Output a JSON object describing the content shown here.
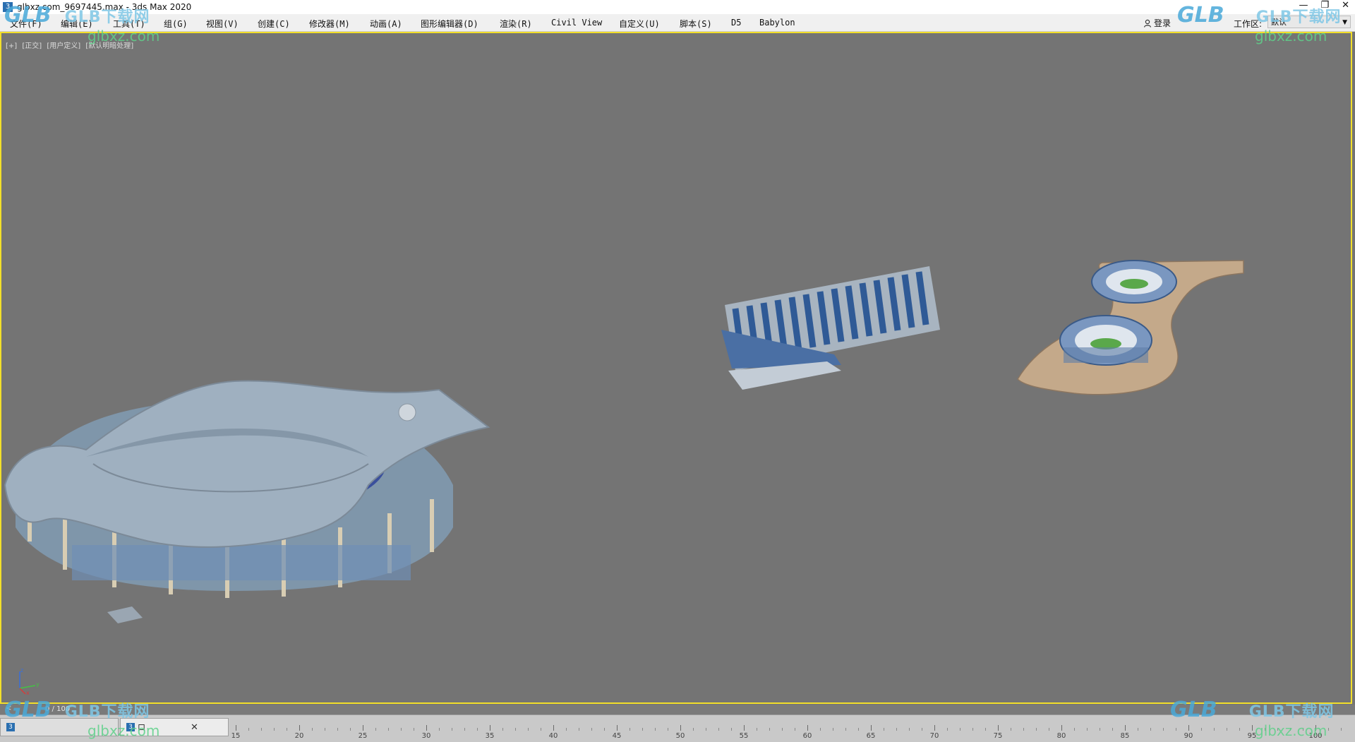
{
  "window": {
    "title": "glbxz.com_9697445.max - 3ds Max 2020",
    "app_icon": "3"
  },
  "menu": {
    "items": [
      "文件(F)",
      "编辑(E)",
      "工具(T)",
      "组(G)",
      "视图(V)",
      "创建(C)",
      "修改器(M)",
      "动画(A)",
      "图形编辑器(D)",
      "渲染(R)",
      "Civil View",
      "自定义(U)",
      "脚本(S)",
      "D5",
      "Babylon"
    ],
    "login_label": "登录",
    "workspace_label": "工作区:",
    "workspace_value": "默认"
  },
  "viewport": {
    "labels": [
      "[+]",
      "[正交]",
      "[用户定义]",
      "[默认明暗处理]"
    ],
    "border_color": "#f2df2a",
    "background": "#747474"
  },
  "axis": {
    "x": "x",
    "y": "y",
    "z": "z"
  },
  "status": {
    "frame_counter": "0 / 100",
    "arrow": "<"
  },
  "tabs": [
    {
      "icon": "3",
      "label": ""
    },
    {
      "icon": "3",
      "label": "口"
    }
  ],
  "timeline": {
    "ticks": [
      "15",
      "20",
      "25",
      "30",
      "35",
      "40",
      "45",
      "50",
      "55",
      "60",
      "65",
      "70",
      "75",
      "80",
      "85",
      "90",
      "95",
      "100"
    ]
  },
  "watermarks": {
    "logo": "GLB",
    "brand": "GLB下载网",
    "site": "glbxz.com"
  }
}
